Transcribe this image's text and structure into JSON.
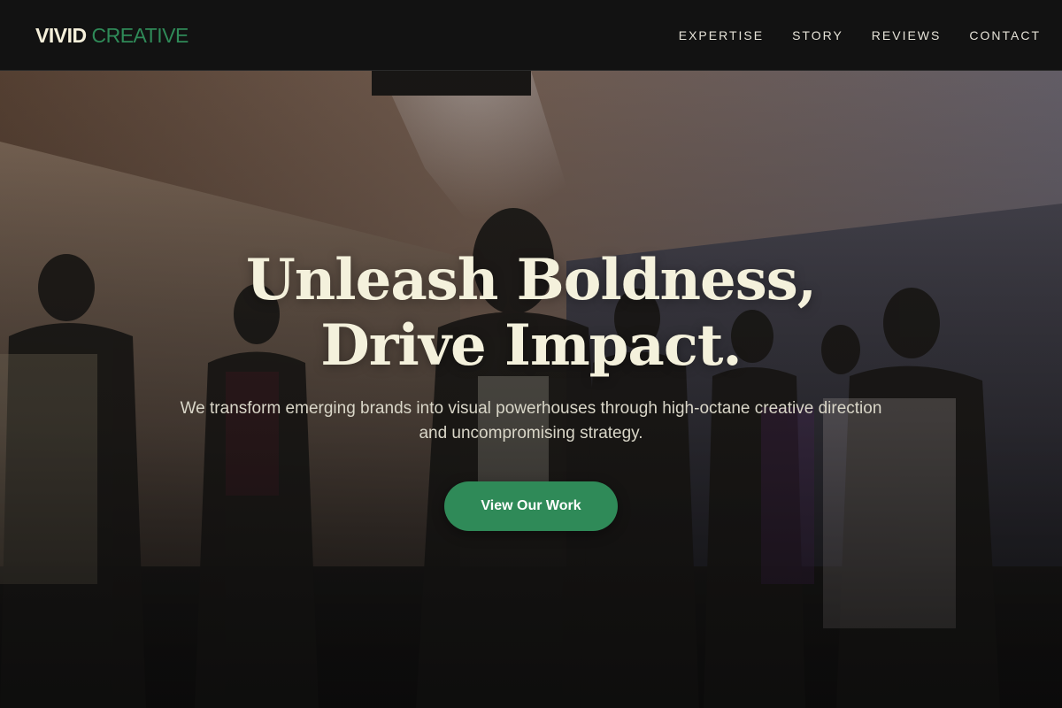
{
  "brand": {
    "primary": "VIVID",
    "secondary": "CREATIVE",
    "primary_color": "#F4EFDA",
    "accent_color": "#2F8A58"
  },
  "nav": {
    "items": [
      {
        "label": "EXPERTISE"
      },
      {
        "label": "STORY"
      },
      {
        "label": "REVIEWS"
      },
      {
        "label": "CONTACT"
      }
    ]
  },
  "hero": {
    "headline_line1": "Unleash Boldness,",
    "headline_line2": "Drive Impact.",
    "subtext": "We transform emerging brands into visual powerhouses through high-octane creative direction and uncompromising strategy.",
    "cta_label": "View Our Work",
    "cta_color": "#2F8A58",
    "headline_color": "#F4F1DC"
  }
}
